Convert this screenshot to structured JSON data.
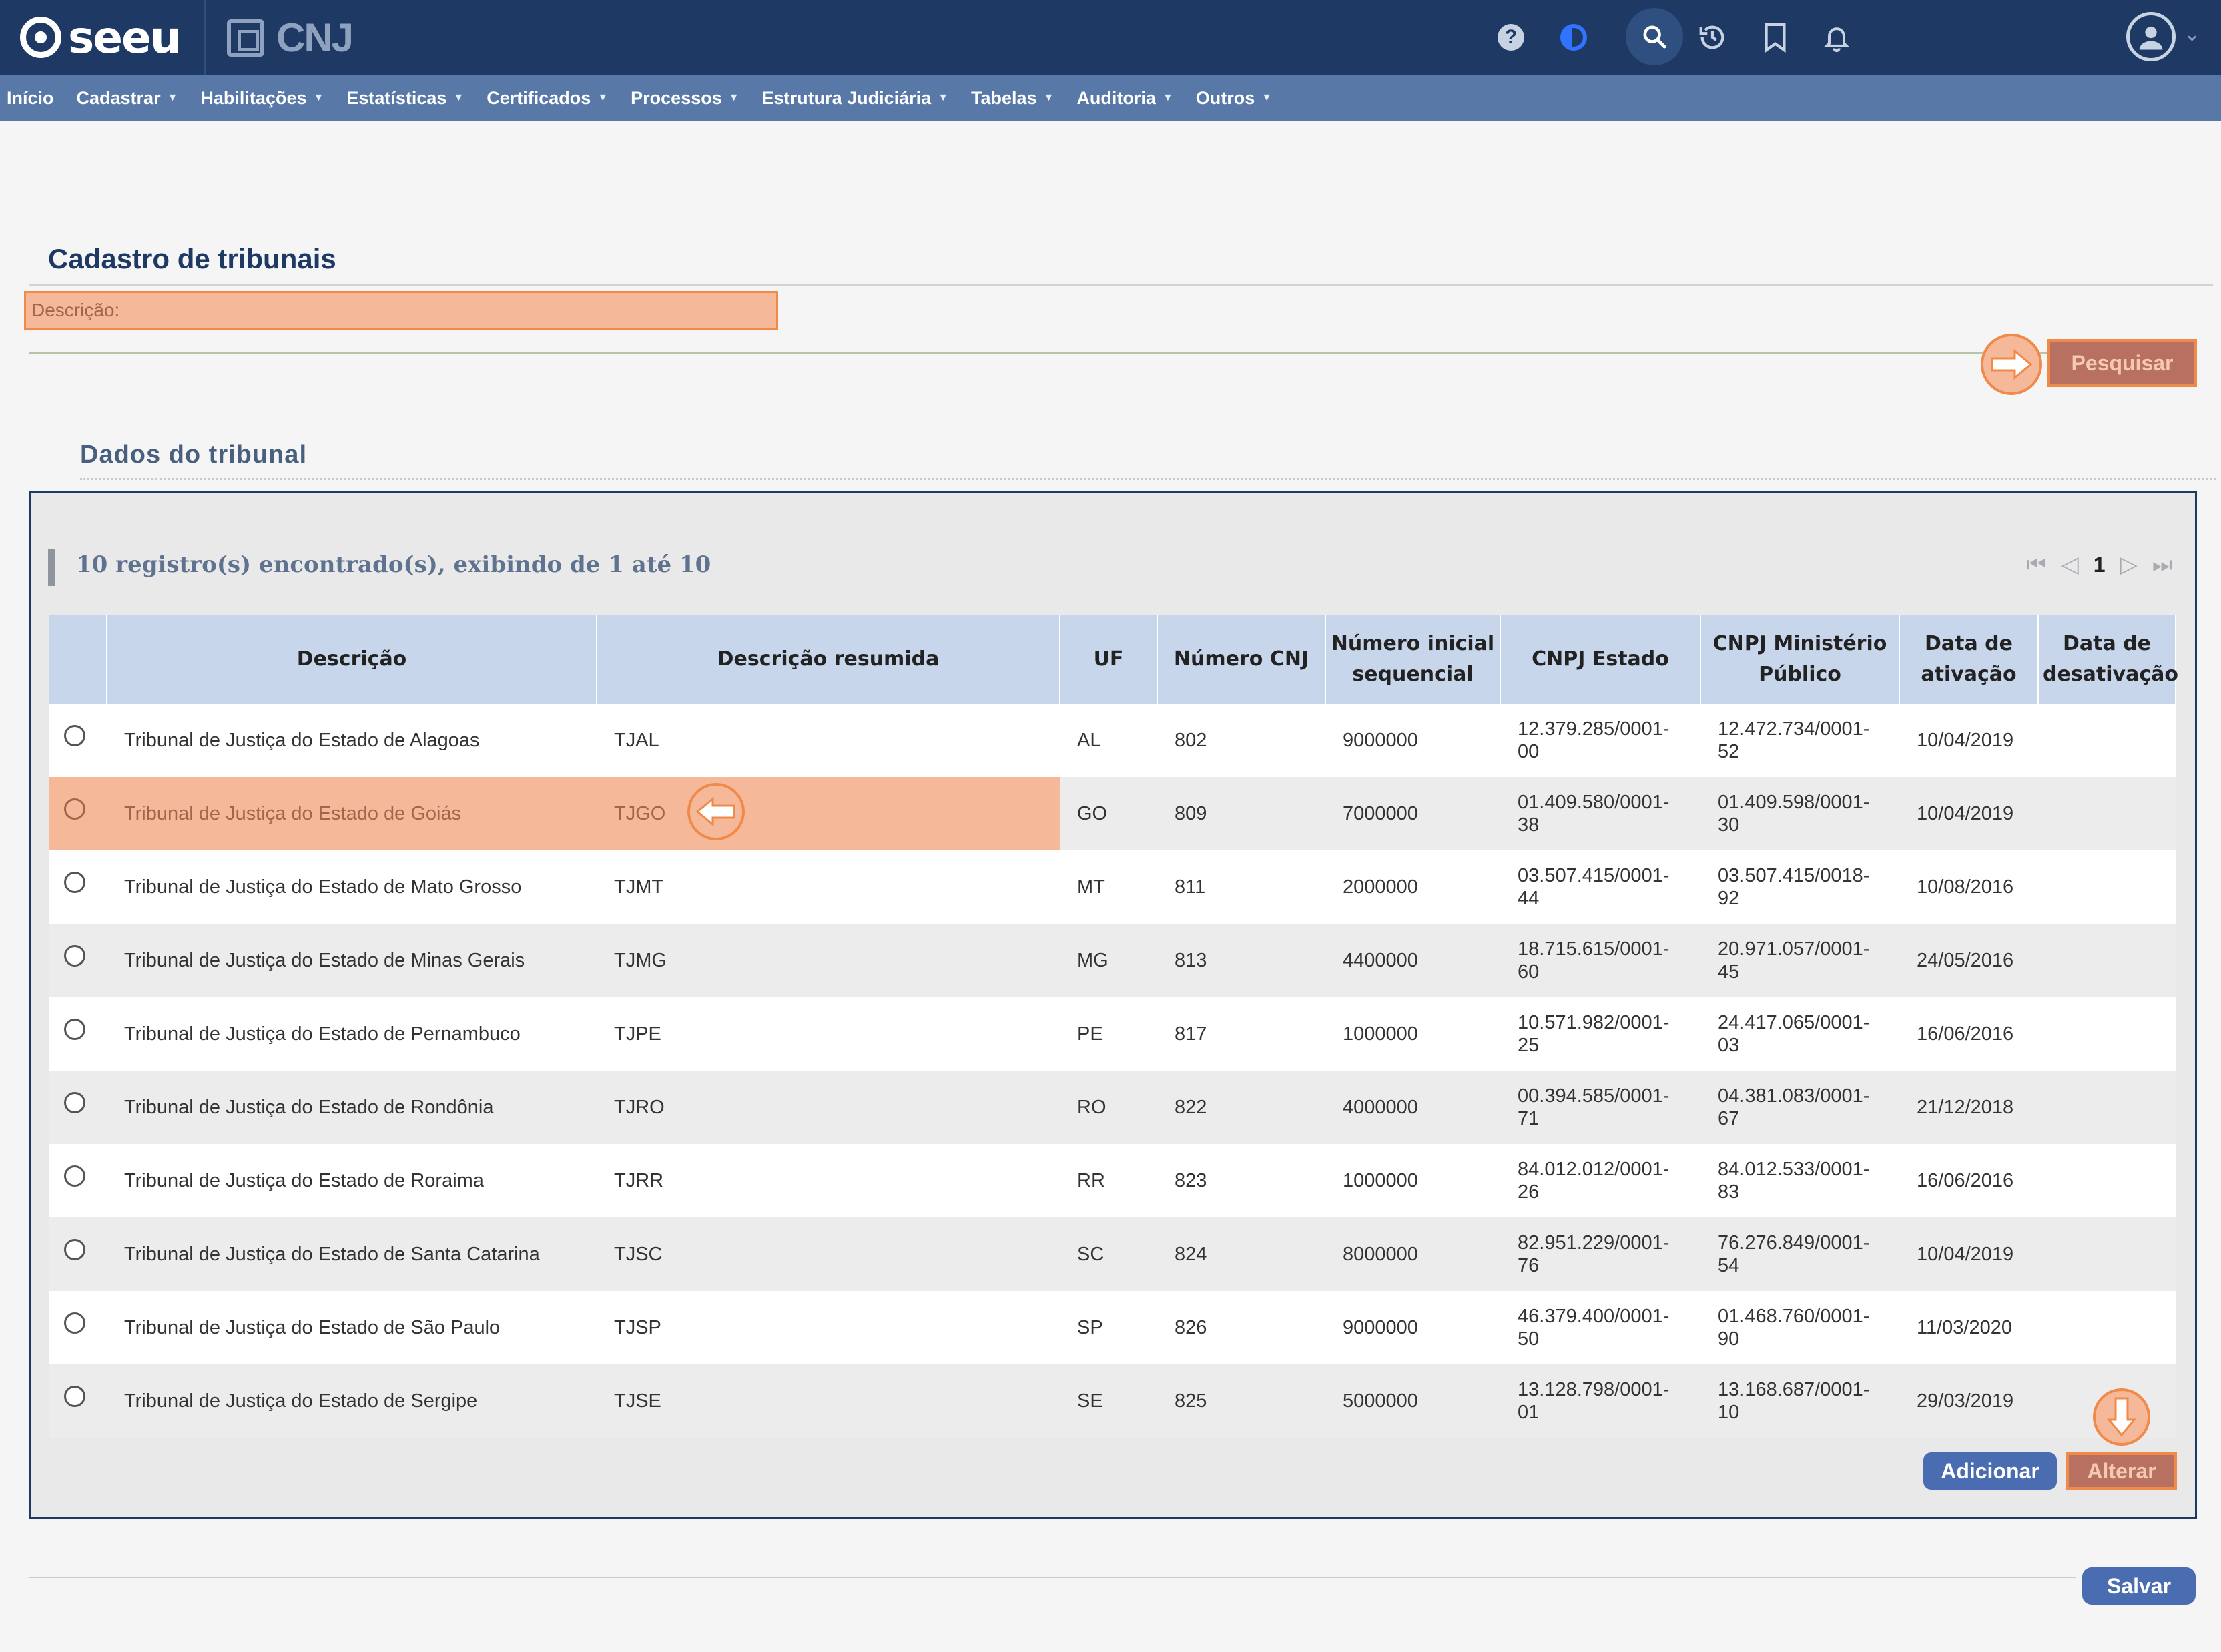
{
  "app": {
    "logo_text": "seeu",
    "partner_text": "CNJ"
  },
  "nav": [
    {
      "label": "Início",
      "has_caret": false
    },
    {
      "label": "Cadastrar",
      "has_caret": true
    },
    {
      "label": "Habilitações",
      "has_caret": true
    },
    {
      "label": "Estatísticas",
      "has_caret": true
    },
    {
      "label": "Certificados",
      "has_caret": true
    },
    {
      "label": "Processos",
      "has_caret": true
    },
    {
      "label": "Estrutura Judiciária",
      "has_caret": true
    },
    {
      "label": "Tabelas",
      "has_caret": true
    },
    {
      "label": "Auditoria",
      "has_caret": true
    },
    {
      "label": "Outros",
      "has_caret": true
    }
  ],
  "page": {
    "title": "Cadastro de tribunais",
    "description_label": "Descrição:",
    "search_button": "Pesquisar",
    "section_title": "Dados do tribunal"
  },
  "results": {
    "summary": "10 registro(s) encontrado(s), exibindo de 1 até 10",
    "current_page": "1"
  },
  "table": {
    "headers": [
      "",
      "Descrição",
      "Descrição resumida",
      "UF",
      "Número CNJ",
      "Número inicial sequencial",
      "CNPJ Estado",
      "CNPJ Ministério Público",
      "Data de ativação",
      "Data de desativação"
    ],
    "rows": [
      {
        "descricao": "Tribunal de Justiça do Estado de Alagoas",
        "resumida": "TJAL",
        "uf": "AL",
        "cnj": "802",
        "seq": "9000000",
        "cnpj_estado": "12.379.285/0001-00",
        "cnpj_mp": "12.472.734/0001-52",
        "ativacao": "10/04/2019",
        "desativacao": ""
      },
      {
        "descricao": "Tribunal de Justiça do Estado de Goiás",
        "resumida": "TJGO",
        "uf": "GO",
        "cnj": "809",
        "seq": "7000000",
        "cnpj_estado": "01.409.580/0001-38",
        "cnpj_mp": "01.409.598/0001-30",
        "ativacao": "10/04/2019",
        "desativacao": ""
      },
      {
        "descricao": "Tribunal de Justiça do Estado de Mato Grosso",
        "resumida": "TJMT",
        "uf": "MT",
        "cnj": "811",
        "seq": "2000000",
        "cnpj_estado": "03.507.415/0001-44",
        "cnpj_mp": "03.507.415/0018-92",
        "ativacao": "10/08/2016",
        "desativacao": ""
      },
      {
        "descricao": "Tribunal de Justiça do Estado de Minas Gerais",
        "resumida": "TJMG",
        "uf": "MG",
        "cnj": "813",
        "seq": "4400000",
        "cnpj_estado": "18.715.615/0001-60",
        "cnpj_mp": "20.971.057/0001-45",
        "ativacao": "24/05/2016",
        "desativacao": ""
      },
      {
        "descricao": "Tribunal de Justiça do Estado de Pernambuco",
        "resumida": "TJPE",
        "uf": "PE",
        "cnj": "817",
        "seq": "1000000",
        "cnpj_estado": "10.571.982/0001-25",
        "cnpj_mp": "24.417.065/0001-03",
        "ativacao": "16/06/2016",
        "desativacao": ""
      },
      {
        "descricao": "Tribunal de Justiça do Estado de Rondônia",
        "resumida": "TJRO",
        "uf": "RO",
        "cnj": "822",
        "seq": "4000000",
        "cnpj_estado": "00.394.585/0001-71",
        "cnpj_mp": "04.381.083/0001-67",
        "ativacao": "21/12/2018",
        "desativacao": ""
      },
      {
        "descricao": "Tribunal de Justiça do Estado de Roraima",
        "resumida": "TJRR",
        "uf": "RR",
        "cnj": "823",
        "seq": "1000000",
        "cnpj_estado": "84.012.012/0001-26",
        "cnpj_mp": "84.012.533/0001-83",
        "ativacao": "16/06/2016",
        "desativacao": ""
      },
      {
        "descricao": "Tribunal de Justiça do Estado de Santa Catarina",
        "resumida": "TJSC",
        "uf": "SC",
        "cnj": "824",
        "seq": "8000000",
        "cnpj_estado": "82.951.229/0001-76",
        "cnpj_mp": "76.276.849/0001-54",
        "ativacao": "10/04/2019",
        "desativacao": ""
      },
      {
        "descricao": "Tribunal de Justiça do Estado de São Paulo",
        "resumida": "TJSP",
        "uf": "SP",
        "cnj": "826",
        "seq": "9000000",
        "cnpj_estado": "46.379.400/0001-50",
        "cnpj_mp": "01.468.760/0001-90",
        "ativacao": "11/03/2020",
        "desativacao": ""
      },
      {
        "descricao": "Tribunal de Justiça do Estado de Sergipe",
        "resumida": "TJSE",
        "uf": "SE",
        "cnj": "825",
        "seq": "5000000",
        "cnpj_estado": "13.128.798/0001-01",
        "cnpj_mp": "13.168.687/0001-10",
        "ativacao": "29/03/2019",
        "desativacao": ""
      }
    ],
    "highlighted_row": 1
  },
  "buttons": {
    "add": "Adicionar",
    "alter": "Alterar",
    "save": "Salvar"
  },
  "colors": {
    "topbar": "#1e3a64",
    "navbar": "#5878a8",
    "highlight": "#f5b99a",
    "highlight_border": "#f08a4a",
    "primary_button": "#4a6cb0"
  },
  "icons": [
    "help-icon",
    "theme-icon",
    "search-icon",
    "history-icon",
    "bookmark-icon",
    "bell-icon",
    "user-avatar-icon"
  ]
}
